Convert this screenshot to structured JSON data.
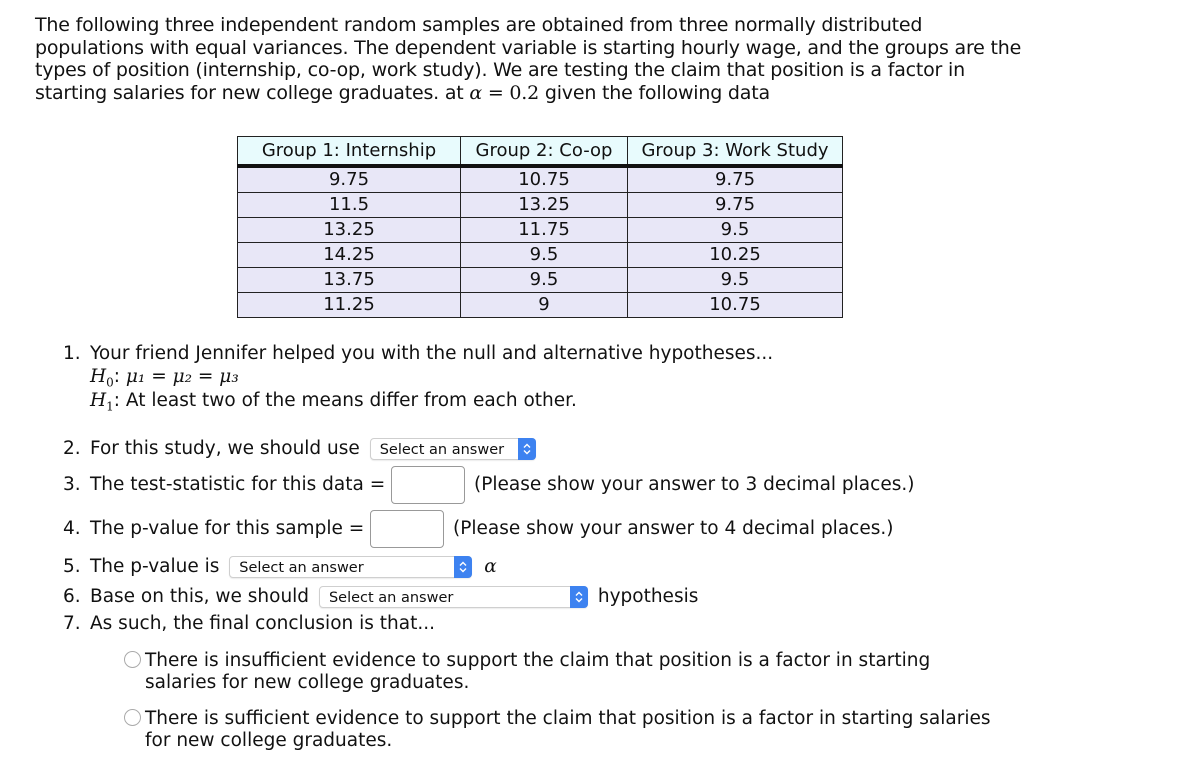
{
  "intro": {
    "text_before_alpha": "The following three independent random samples are obtained from three normally distributed populations with equal variances.  The dependent variable is starting hourly wage, and the groups are the types of position (internship, co-op, work study). We are testing the claim that position is a factor in starting salaries for new college graduates. at ",
    "alpha_symbol": "α",
    "equals": " = ",
    "alpha_value": "0.2",
    "text_after_alpha": " given the following data"
  },
  "table": {
    "headers": [
      "Group 1: Internship",
      "Group 2: Co-op",
      "Group 3: Work Study"
    ],
    "rows": [
      [
        "9.75",
        "10.75",
        "9.75"
      ],
      [
        "11.5",
        "13.25",
        "9.75"
      ],
      [
        "13.25",
        "11.75",
        "9.5"
      ],
      [
        "14.25",
        "9.5",
        "10.25"
      ],
      [
        "13.75",
        "9.5",
        "9.5"
      ],
      [
        "11.25",
        "9",
        "10.75"
      ]
    ]
  },
  "questions": {
    "q1": {
      "number": "1.",
      "text": "Your friend Jennifer helped you with the null and alternative hypotheses...",
      "h0_label": "H",
      "h0_sub": "0",
      "h0_expr": "μ₁ = μ₂ = μ₃",
      "h1_label": "H",
      "h1_sub": "1",
      "h1_text": "At least two of the means differ from each other."
    },
    "q2": {
      "number": "2.",
      "text": "For this study, we should use",
      "select_value": "Select an answer"
    },
    "q3": {
      "number": "3.",
      "text": "The test-statistic for this data =",
      "input_value": "",
      "note": "(Please show your answer to 3 decimal places.)"
    },
    "q4": {
      "number": "4.",
      "text": "The p-value for this sample =",
      "input_value": "",
      "note": "(Please show your answer to 4 decimal places.)"
    },
    "q5": {
      "number": "5.",
      "text": "The p-value is",
      "select_value": "Select an answer",
      "suffix": "α"
    },
    "q6": {
      "number": "6.",
      "text": "Base on this, we should",
      "select_value": "Select an answer",
      "suffix": "hypothesis"
    },
    "q7": {
      "number": "7.",
      "text": "As such, the final conclusion is that..."
    }
  },
  "conclusions": [
    {
      "text": "There is insufficient evidence to support the claim that position is a factor in starting salaries for new college graduates.",
      "selected": false
    },
    {
      "text": "There is sufficient evidence to support the claim that position is a factor in starting salaries for new college graduates.",
      "selected": false
    }
  ],
  "colors": {
    "header_bg": "#e8fbfd",
    "cell_bg": "#e8e7f7",
    "select_arrow": "#3d82f0"
  }
}
